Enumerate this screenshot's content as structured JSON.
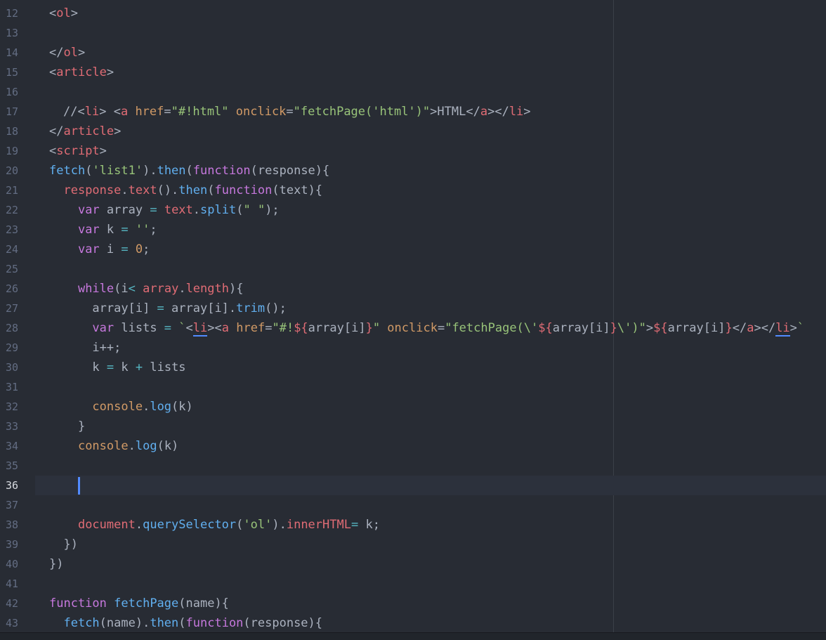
{
  "editor": {
    "line_numbers": [
      "12",
      "13",
      "14",
      "15",
      "16",
      "17",
      "18",
      "19",
      "20",
      "21",
      "22",
      "23",
      "24",
      "25",
      "26",
      "27",
      "28",
      "29",
      "30",
      "31",
      "32",
      "33",
      "34",
      "35",
      "36",
      "37",
      "38",
      "39",
      "40",
      "41",
      "42",
      "43"
    ],
    "active_line": "36",
    "colors": {
      "background": "#282c34",
      "active_line": "#2c313c",
      "cursor": "#528bff",
      "tag": "#e06c75",
      "string": "#98c379",
      "keyword": "#c678dd",
      "function": "#61afef",
      "number": "#d19a66"
    },
    "code": {
      "l12": {
        "open": "<",
        "tag": "ol",
        "close": ">"
      },
      "l14": {
        "open": "</",
        "tag": "ol",
        "close": ">"
      },
      "l15": {
        "open": "<",
        "tag": "article",
        "close": ">"
      },
      "l17": {
        "comment": "//",
        "li_open": "<",
        "li": "li",
        "li_close": "> ",
        "a_open": "<",
        "a": "a",
        "href_attr": " href",
        "eq1": "=",
        "href_val": "\"#!html\"",
        "onclick_attr": " onclick",
        "eq2": "=",
        "onclick_val": "\"fetchPage('html')\"",
        "gt": ">",
        "text": "HTML",
        "a_end_open": "</",
        "a_end": "a",
        "a_end_close": ">",
        "li_end_open": "</",
        "li_end": "li",
        "li_end_close": ">"
      },
      "l18": {
        "open": "</",
        "tag": "article",
        "close": ">"
      },
      "l19": {
        "open": "<",
        "tag": "script",
        "close": ">"
      },
      "l20": {
        "fetch": "fetch",
        "p1": "(",
        "str": "'list1'",
        "p2": ").",
        "then": "then",
        "p3": "(",
        "kw": "function",
        "p4": "(response){"
      },
      "l21": {
        "indent": "  ",
        "response": "response",
        "dot1": ".",
        "text": "text",
        "p1": "().",
        "then": "then",
        "p2": "(",
        "kw": "function",
        "p3": "(text){"
      },
      "l22": {
        "indent": "    ",
        "kw": "var",
        "rest1": " array ",
        "eq": "=",
        "sp": " ",
        "text": "text",
        "dot": ".",
        "split": "split",
        "p1": "(",
        "str": "\" \"",
        "p2": ");"
      },
      "l23": {
        "indent": "    ",
        "kw": "var",
        "rest1": " k ",
        "eq": "=",
        "sp": " ",
        "str": "''",
        "end": ";"
      },
      "l24": {
        "indent": "    ",
        "kw": "var",
        "rest1": " i ",
        "eq": "=",
        "sp": " ",
        "num": "0",
        "end": ";"
      },
      "l26": {
        "indent": "    ",
        "kw": "while",
        "p1": "(i",
        "lt": "<",
        "sp": " ",
        "array": "array",
        "dot": ".",
        "length": "length",
        "p2": "){"
      },
      "l27": {
        "indent": "      ",
        "lhs": "array[i] ",
        "eq": "=",
        "rhs1": " array[i].",
        "trim": "trim",
        "p1": "();"
      },
      "l28": {
        "indent": "      ",
        "kw": "var",
        "rest1": " lists ",
        "eq": "=",
        "sp": " ",
        "bt": "`",
        "lt1": "<",
        "li": "li",
        "gt1": ">",
        "lt2": "<",
        "a": "a",
        "href_attr": " href",
        "eq1": "=",
        "q1": "\"#!",
        "d1": "${",
        "v1": "array[i]",
        "c1": "}",
        "q2": "\"",
        "onclick_attr": " onclick",
        "eq2": "=",
        "q3": "\"fetchPage(\\'",
        "d2": "${",
        "v2": "array[i]",
        "c2": "}",
        "q4": "\\')\"",
        "gt2": ">",
        "d3": "${",
        "v3": "array[i]",
        "c3": "}",
        "lt3": "</",
        "a2": "a",
        "gt3": ">",
        "lt4": "</",
        "li2": "li",
        "gt4": ">",
        "bt2": "`"
      },
      "l29": {
        "indent": "      ",
        "text": "i++;"
      },
      "l30": {
        "indent": "      ",
        "k1": "k ",
        "eq": "=",
        "mid": " k ",
        "plus": "+",
        "rest": " lists"
      },
      "l32": {
        "indent": "      ",
        "console": "console",
        "dot": ".",
        "log": "log",
        "rest": "(k)"
      },
      "l33": {
        "indent": "    ",
        "text": "}"
      },
      "l34": {
        "indent": "    ",
        "console": "console",
        "dot": ".",
        "log": "log",
        "rest": "(k)"
      },
      "l38": {
        "indent": "    ",
        "document": "document",
        "dot": ".",
        "qs": "querySelector",
        "p1": "(",
        "str": "'ol'",
        "p2": ").",
        "inner": "innerHTML",
        "eq": "=",
        "rest": " k;"
      },
      "l39": {
        "indent": "  ",
        "text": "})"
      },
      "l40": {
        "text": "})"
      },
      "l42": {
        "kw": "function",
        "sp": " ",
        "name": "fetchPage",
        "rest": "(name){"
      },
      "l43": {
        "indent": "  ",
        "fetch": "fetch",
        "p1": "(name).",
        "then": "then",
        "p2": "(",
        "kw": "function",
        "p3": "(response){"
      }
    }
  }
}
